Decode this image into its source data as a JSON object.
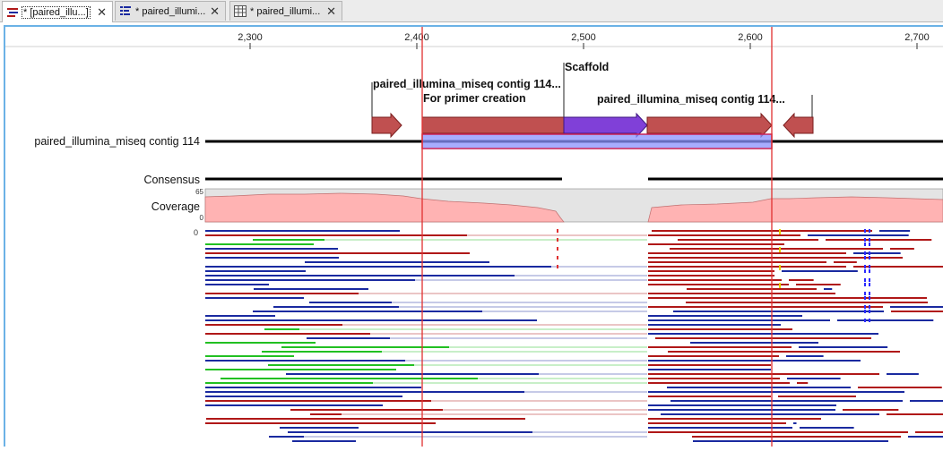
{
  "tabs": [
    {
      "label": "* [paired_illu...]",
      "icon": "reads-track-icon",
      "close": "✕",
      "active": true
    },
    {
      "label": "* paired_illumi...",
      "icon": "annotation-list-icon",
      "close": "✕",
      "active": false
    },
    {
      "label": "* paired_illumi...",
      "icon": "table-icon",
      "close": "✕",
      "active": false
    }
  ],
  "ruler": {
    "ticks": [
      "2,300",
      "2,400",
      "2,500",
      "2,600",
      "2,700"
    ]
  },
  "annotations": {
    "contig_left": "paired_illumina_miseq contig 114...",
    "primer_creation": "For primer creation",
    "scaffold": "Scaffold",
    "contig_right": "paired_illumina_miseq contig 114..."
  },
  "tracks": {
    "reference": "paired_illumina_miseq contig 114",
    "consensus": "Consensus",
    "coverage": "Coverage",
    "coverage_max": "65",
    "coverage_min": "0",
    "reads_offset": "0"
  },
  "colors": {
    "forward_read": "#1a2aa0",
    "reverse_read": "#b01818",
    "paired_green": "#22c022",
    "selection": "#e03030",
    "annotation_red": "#c05050",
    "annotation_purple": "#8040d8",
    "coverage_fill": "#ffb3b3",
    "accent": "#6bb2e6"
  }
}
